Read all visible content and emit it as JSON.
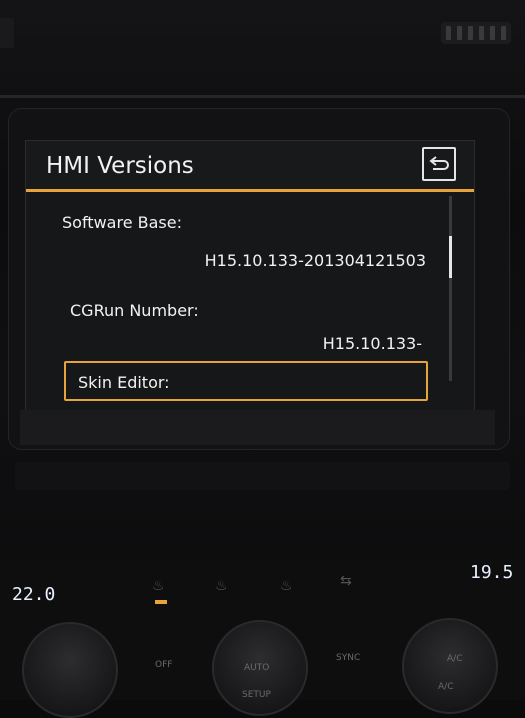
{
  "screen": {
    "title": "HMI Versions",
    "rows": [
      {
        "label": "Software Base:",
        "value": "H15.10.133-201304121503"
      },
      {
        "label": "CGRun Number:",
        "value": "H15.10.133-"
      },
      {
        "label": "Skin Editor:",
        "value": ""
      }
    ]
  },
  "climate": {
    "left_temp": "22.0",
    "right_temp": "19.5",
    "off_label": "OFF",
    "auto_label": "AUTO",
    "setup_label": "SETUP",
    "sync_label": "SYNC",
    "ac_label": "A/C"
  },
  "colors": {
    "accent": "#e8a33a",
    "screen_bg": "#151718",
    "text": "#f2f2f2"
  }
}
